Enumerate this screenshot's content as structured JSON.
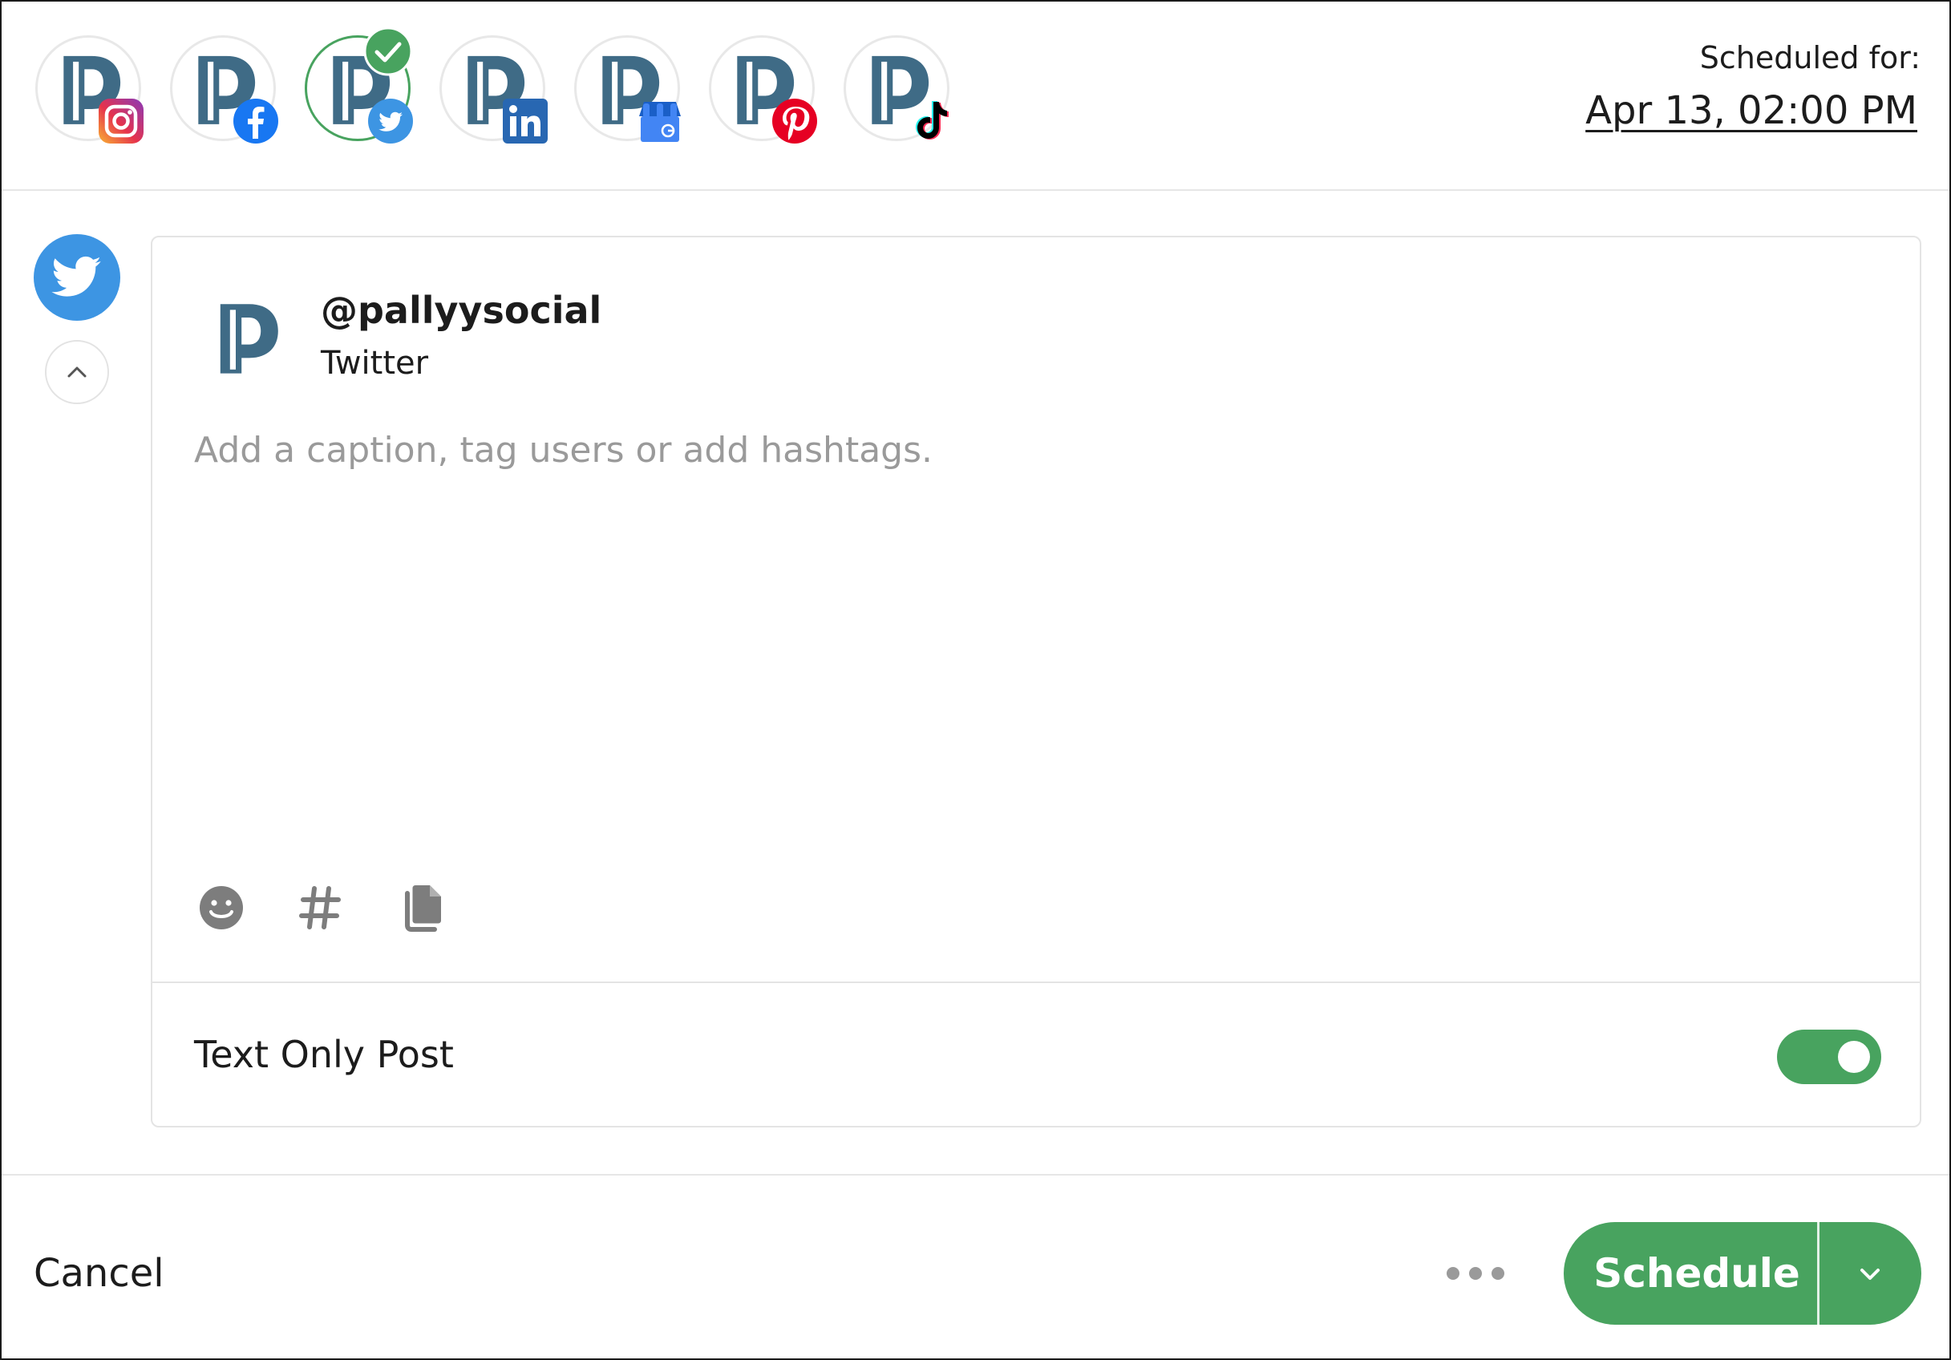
{
  "accounts": [
    {
      "network": "instagram",
      "selected": false
    },
    {
      "network": "facebook",
      "selected": false
    },
    {
      "network": "twitter",
      "selected": true
    },
    {
      "network": "linkedin",
      "selected": false
    },
    {
      "network": "google-business",
      "selected": false
    },
    {
      "network": "pinterest",
      "selected": false
    },
    {
      "network": "tiktok",
      "selected": false
    }
  ],
  "schedule": {
    "label": "Scheduled for:",
    "date": "Apr 13, 02:00 PM"
  },
  "composer": {
    "handle": "@pallyysocial",
    "network": "Twitter",
    "caption_placeholder": "Add a caption, tag users or add hashtags.",
    "caption_value": "",
    "tools": [
      "emoji-icon",
      "hashtag-icon",
      "copy-icon"
    ],
    "text_only_label": "Text Only Post",
    "text_only_enabled": true
  },
  "footer": {
    "cancel_label": "Cancel",
    "schedule_label": "Schedule"
  },
  "colors": {
    "accent_green": "#48a35f",
    "twitter_blue": "#3d95e3",
    "brand_slate": "#3f6b86",
    "placeholder_gray": "#9a9a9a"
  }
}
